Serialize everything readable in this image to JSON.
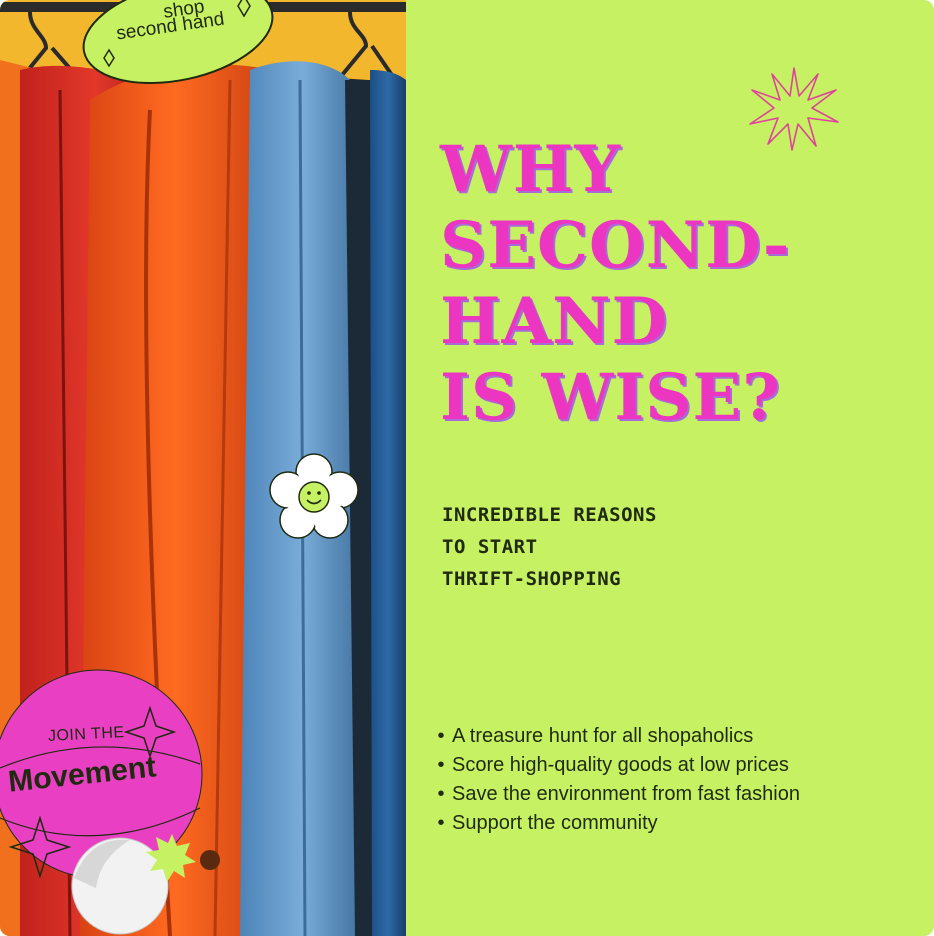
{
  "sticker_top": {
    "line1": "shop",
    "line2": "second hand"
  },
  "title_lines": [
    "Why",
    "Second-",
    "Hand",
    "is Wise?"
  ],
  "subtitle_lines": [
    "Incredible reasons",
    "to start",
    "thrift-shopping"
  ],
  "bullets": [
    "A treasure hunt for all shopaholics",
    "Score high-quality goods at low prices",
    "Save the environment from fast fashion",
    "Support the community"
  ],
  "sticker_bottom": {
    "line1": "JOIN THE",
    "line2": "Movement"
  },
  "icons": [
    "starburst-icon",
    "flower-smiley-icon",
    "sparkle-icon",
    "burst-icon"
  ],
  "colors": {
    "background": "#c6f162",
    "title": "#ec36c1",
    "text": "#1f2a10",
    "sticker_pink": "#e93fc3"
  }
}
